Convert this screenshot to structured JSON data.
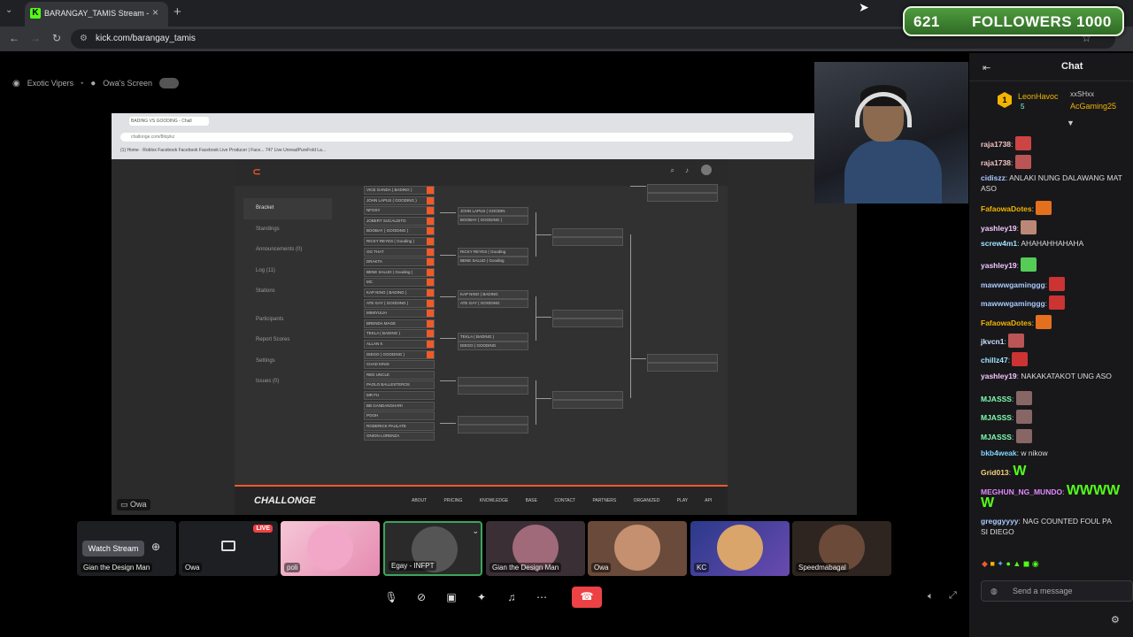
{
  "browser": {
    "tab_title": "BARANGAY_TAMIS Stream - W...",
    "url": "kick.com/barangay_tamis",
    "favicon_letter": "K"
  },
  "overlay": {
    "followers_current": "621",
    "followers_label": "FOLLOWERS",
    "followers_goal": "1000"
  },
  "call": {
    "server": "Exotic Vipers",
    "screen_label": "Owa's Screen",
    "screen_owner": "Owa",
    "watch_button": "Watch Stream",
    "live_badge": "LIVE",
    "tiles": [
      {
        "name": "Gian the Design Man"
      },
      {
        "name": "Owa"
      },
      {
        "name": "poli"
      },
      {
        "name": "Egay - INFPT"
      },
      {
        "name": "Gian the Design Man"
      },
      {
        "name": "Owa"
      },
      {
        "name": "KC"
      },
      {
        "name": "Speedmabagal"
      }
    ]
  },
  "challonge": {
    "sidebar": [
      "Bracket",
      "Standings",
      "Announcements (0)",
      "Log (11)",
      "Stations",
      "Participants",
      "Report Scores",
      "Settings",
      "Issues (0)"
    ],
    "brand": "CHALLONGE",
    "footer_links": "ABOUT PRICING KNOWLEDGE BASE CONTACT PARTNERS ORGANIZED PLAY API",
    "round1": [
      "VICE GANDA ( BADING )",
      "JOHN LAPUS ( GOODING )",
      "NFOSY",
      "JOBERT SUCALDITO",
      "BOOBAY ( GOODING )",
      "RICKY REYES ( Gooding )",
      "OG THAT",
      "DRAKTA",
      "BENE SALUD ( Gooding )",
      "MC",
      "KAP NINO ( BADING )",
      "ATE GAY ( GOODING )",
      "MIMIYUUH",
      "BRENDA MAGE",
      "TEKLA ( BADING )",
      "ALLAN K",
      "DIEGO ( GOODING )",
      "CHAD KINIS",
      "RED UNCLE",
      "PAOLO BALLESTEROS",
      "MR FU",
      "BB GANDANGHARI",
      "POOH",
      "RODERICK PAULATE",
      "ONION LORENZA"
    ],
    "round2": [
      "JOHN LAPUS ( GOODIN",
      "BOOBAY ( GOODING )",
      "RICKY REYES ( Gooding",
      "BENE SALUD ( Gooding",
      "KAP NINO ( BADING",
      "ATE GAY ( GOODING",
      "TEKLA ( BADING )",
      "DIEGO ( GOODING"
    ]
  },
  "chat": {
    "title": "Chat",
    "pinned": {
      "gifter": "LeonHavoc",
      "gift_count": "5",
      "second": "xxSHxx",
      "third": "AcGaming25"
    },
    "messages": [
      {
        "user": "raja1738",
        "text": "",
        "color": "#f0c0c0"
      },
      {
        "user": "raja1738",
        "text": "",
        "color": "#f0c0c0"
      },
      {
        "user": "cidiszz",
        "text": "ANLAKI NUNG DALAWANG MAT",
        "color": "#a9c9ff"
      },
      {
        "user": "",
        "text": "ASO",
        "color": "#fff"
      },
      {
        "user": "FafaowaDotes",
        "text": "",
        "color": "#f2b400"
      },
      {
        "user": "yashley19",
        "text": "",
        "color": "#f5c6ff"
      },
      {
        "user": "screw4m1",
        "text": "AHAHAHHAHAHA",
        "color": "#9fe3ff"
      },
      {
        "user": "yashley19",
        "text": "",
        "color": "#f5c6ff"
      },
      {
        "user": "mawwwgaminggg",
        "text": "",
        "color": "#a9c9ff"
      },
      {
        "user": "mawwwgaminggg",
        "text": "",
        "color": "#a9c9ff"
      },
      {
        "user": "FafaowaDotes",
        "text": "",
        "color": "#f2b400"
      },
      {
        "user": "jkvcn1",
        "text": "",
        "color": "#c9e0ff"
      },
      {
        "user": "chillz47",
        "text": "",
        "color": "#9fe3ff"
      },
      {
        "user": "yashley19",
        "text": "NAKAKATAKOT UNG ASO",
        "color": "#f5c6ff"
      },
      {
        "user": "MJASSS",
        "text": "",
        "color": "#7fffb0"
      },
      {
        "user": "MJASSS",
        "text": "",
        "color": "#7fffb0"
      },
      {
        "user": "MJASSS",
        "text": "",
        "color": "#7fffb0"
      },
      {
        "user": "bkb4weak",
        "text": "w nikow",
        "color": "#7fd4ff"
      },
      {
        "user": "Grid013",
        "text": "W",
        "color": "#f5d27a"
      },
      {
        "user": "MEGHUN_NG_MUNDO",
        "text": "WWWW",
        "color": "#e38aff"
      },
      {
        "user": "",
        "text": "W",
        "color": "#fff"
      },
      {
        "user": "greggyyyy",
        "text": "NAG COUNTED FOUL PA",
        "color": "#a9c9ff"
      },
      {
        "user": "",
        "text": "SI DIEGO",
        "color": "#fff"
      }
    ],
    "placeholder": "Send a message"
  }
}
